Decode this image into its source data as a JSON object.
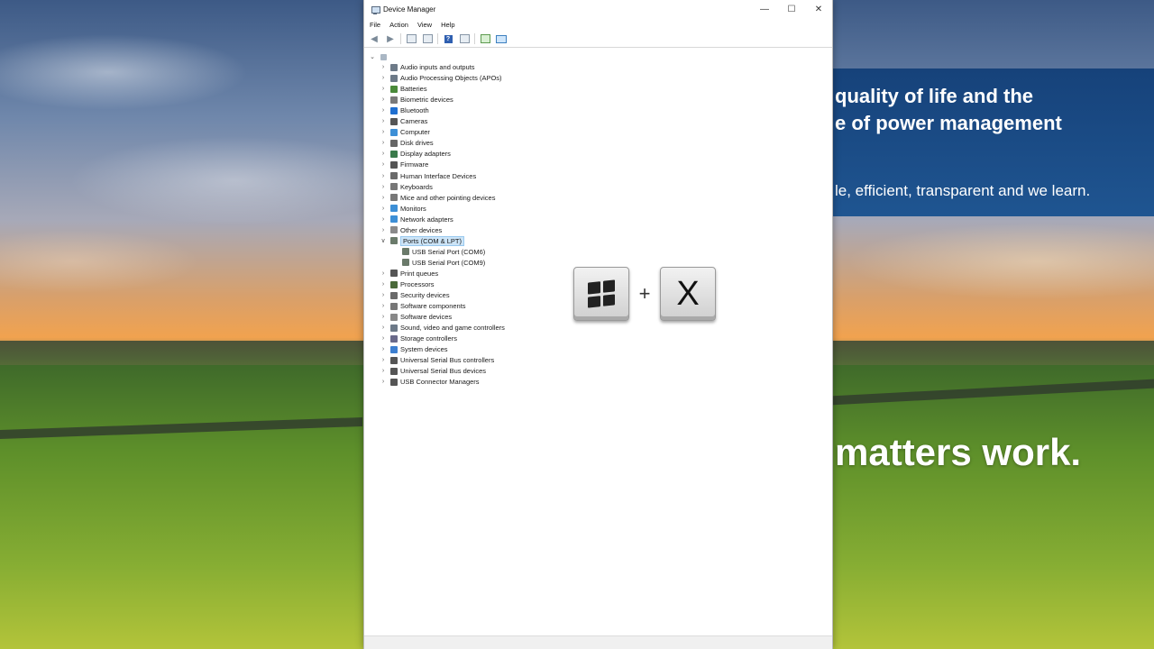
{
  "window": {
    "title": "Device Manager",
    "caption_buttons": {
      "minimize": "—",
      "maximize": "☐",
      "close": "✕"
    }
  },
  "menu": [
    "File",
    "Action",
    "View",
    "Help"
  ],
  "toolbar_icons": [
    "back-arrow-icon",
    "forward-arrow-icon",
    "properties-icon",
    "show-hidden-icon",
    "help-icon",
    "update-driver-icon",
    "scan-hardware-icon",
    "monitor-icon"
  ],
  "tree": {
    "root_icon": "computer-icon",
    "items": [
      {
        "label": "Audio inputs and outputs",
        "icon": "speaker-icon",
        "expanded": false
      },
      {
        "label": "Audio Processing Objects (APOs)",
        "icon": "speaker-icon",
        "expanded": false
      },
      {
        "label": "Batteries",
        "icon": "battery-icon",
        "expanded": false
      },
      {
        "label": "Biometric devices",
        "icon": "fingerprint-icon",
        "expanded": false
      },
      {
        "label": "Bluetooth",
        "icon": "bluetooth-icon",
        "expanded": false
      },
      {
        "label": "Cameras",
        "icon": "camera-icon",
        "expanded": false
      },
      {
        "label": "Computer",
        "icon": "monitor-icon",
        "expanded": false
      },
      {
        "label": "Disk drives",
        "icon": "disk-icon",
        "expanded": false
      },
      {
        "label": "Display adapters",
        "icon": "display-adapter-icon",
        "expanded": false
      },
      {
        "label": "Firmware",
        "icon": "chip-icon",
        "expanded": false
      },
      {
        "label": "Human Interface Devices",
        "icon": "hid-icon",
        "expanded": false
      },
      {
        "label": "Keyboards",
        "icon": "keyboard-icon",
        "expanded": false
      },
      {
        "label": "Mice and other pointing devices",
        "icon": "mouse-icon",
        "expanded": false
      },
      {
        "label": "Monitors",
        "icon": "monitor-icon",
        "expanded": false
      },
      {
        "label": "Network adapters",
        "icon": "network-icon",
        "expanded": false
      },
      {
        "label": "Other devices",
        "icon": "unknown-device-icon",
        "expanded": false
      },
      {
        "label": "Ports (COM & LPT)",
        "icon": "port-icon",
        "expanded": true,
        "selected": true,
        "children": [
          "USB Serial Port (COM6)",
          "USB Serial Port (COM9)"
        ]
      },
      {
        "label": "Print queues",
        "icon": "printer-icon",
        "expanded": false
      },
      {
        "label": "Processors",
        "icon": "processor-icon",
        "expanded": false
      },
      {
        "label": "Security devices",
        "icon": "security-icon",
        "expanded": false
      },
      {
        "label": "Software components",
        "icon": "component-icon",
        "expanded": false
      },
      {
        "label": "Software devices",
        "icon": "software-device-icon",
        "expanded": false
      },
      {
        "label": "Sound, video and game controllers",
        "icon": "speaker-icon",
        "expanded": false
      },
      {
        "label": "Storage controllers",
        "icon": "storage-icon",
        "expanded": false
      },
      {
        "label": "System devices",
        "icon": "folder-icon",
        "expanded": false
      },
      {
        "label": "Universal Serial Bus controllers",
        "icon": "usb-icon",
        "expanded": false
      },
      {
        "label": "Universal Serial Bus devices",
        "icon": "usb-icon",
        "expanded": false
      },
      {
        "label": "USB Connector Managers",
        "icon": "usb-icon",
        "expanded": false
      }
    ]
  },
  "banner": {
    "line1": "quality of life and the",
    "line2": "e of power management",
    "line3": "le, efficient, transparent and we learn."
  },
  "slogan": "matters work.",
  "keys": {
    "key1_icon": "windows-logo-icon",
    "plus": "+",
    "key2": "X"
  },
  "colors": {
    "selection": "#cce4f7",
    "banner": "#1a4a85"
  }
}
